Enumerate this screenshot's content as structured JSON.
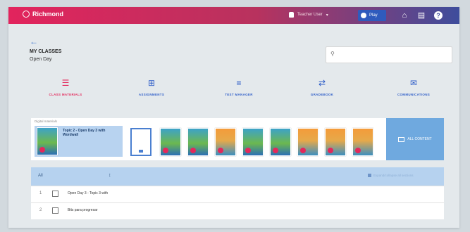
{
  "topbar": {
    "brand": "Richmond",
    "user_name": "Teacher User",
    "user_chevron": "▾",
    "chip_label": "Play",
    "icons": [
      "home-icon",
      "notifications-icon",
      "help-icon"
    ],
    "colors": {
      "gradient_start": "#e2245d",
      "gradient_end": "#3e4d9c",
      "chip": "#2f5bbd"
    }
  },
  "back_arrow": "←",
  "class_header": {
    "title": "MY CLASSES",
    "subtitle": "Open Day"
  },
  "search": {
    "placeholder": "",
    "icon": "search-icon"
  },
  "nav": [
    {
      "label": "CLASS MATERIALS",
      "icon": "materials-icon",
      "glyph": "☰",
      "active": true
    },
    {
      "label": "ASSIGNMENTS",
      "icon": "assignments-icon",
      "glyph": "⊞",
      "active": false
    },
    {
      "label": "TEST MANAGER",
      "icon": "test-manager-icon",
      "glyph": "≡",
      "active": false
    },
    {
      "label": "GRADEBOOK",
      "icon": "gradebook-icon",
      "glyph": "⇄",
      "active": false
    },
    {
      "label": "COMMUNICATIONS",
      "icon": "communications-icon",
      "glyph": "✉",
      "active": false
    }
  ],
  "books": {
    "section_label": "Digital materials",
    "selected_title": "Topic 2 - Open Day 3 with Wordwall",
    "covers": [
      "blue",
      "blue",
      "blue",
      "orange",
      "blue",
      "blue",
      "orange",
      "orange",
      "orange"
    ],
    "all_content_label": "ALL CONTENT"
  },
  "table": {
    "col_all": "All",
    "sort_glyph": "↕",
    "expand_label": "Expand/collapse all sections",
    "rows": [
      {
        "num": "1",
        "text": "Open Day 3 - Topic 3 with"
      },
      {
        "num": "2",
        "text": "Bits para progresar"
      }
    ]
  },
  "accent_colors": {
    "active": "#e3285b",
    "link": "#2f5ec8",
    "panel": "#b6d2ef"
  }
}
